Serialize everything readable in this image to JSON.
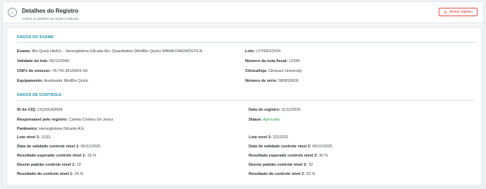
{
  "header": {
    "title": "Detalhes do Registro",
    "subtitle": "Confira os detalhes do registro realizado",
    "cancel_label": "Anular registro"
  },
  "exam_section": {
    "title": "DADOS DO EXAME",
    "left": [
      {
        "label": "Exame:",
        "value": "Bio Quick HbA1c - Hemoglobina Glicada A1c Quantitativo (MiniBio Quick) WAMA DIAGNÓSTICA"
      },
      {
        "label": "Validade do lote:",
        "value": "05/12/2040"
      },
      {
        "label": "CNPJ do emissor:",
        "value": "78.742.961/0001-69"
      },
      {
        "label": "Equipamento:",
        "value": "Analisador MiniBio Quick"
      }
    ],
    "right": [
      {
        "label": "Lote:",
        "value": "LOTERX2024"
      },
      {
        "label": "Número da nota fiscal:",
        "value": "12345"
      },
      {
        "label": "Clínica/loja:",
        "value": "Clinicarx University"
      },
      {
        "label": "Número de série:",
        "value": "080819918"
      }
    ]
  },
  "control_section": {
    "title": "DADOS DE CONTROLE",
    "left": [
      {
        "label": "ID do CIQ:",
        "value": "CIQ331A0004"
      },
      {
        "label": "Responsável pelo registro:",
        "value": "Camila Cristina De Jesus"
      },
      {
        "label": "Parâmetro:",
        "value": "Hemoglobina Glicada A1c"
      },
      {
        "label": "Lote nível 1:",
        "value": "11111"
      },
      {
        "label": "Data de validade controle nível 1:",
        "value": "06/12/2025"
      },
      {
        "label": "Resultado esperado controle nível 1:",
        "value": "15 %"
      },
      {
        "label": "Desvio padrão controle nível 1:",
        "value": "10"
      },
      {
        "label": "Resultado do controle nível 1:",
        "value": "26 %"
      }
    ],
    "right": [
      {
        "label": "Data do registro:",
        "value": "11/11/2025"
      },
      {
        "label": "Status:",
        "value": "Aprovado"
      },
      {
        "label": "Lote nível 2:",
        "value": "2222222"
      },
      {
        "label": "Data de validade controle nível 2:",
        "value": "06/12/2025"
      },
      {
        "label": "Resultado esperado controle nível 2:",
        "value": "30 %"
      },
      {
        "label": "Desvio padrão controle nível 2:",
        "value": "10"
      },
      {
        "label": "Resultado do controle nível 2:",
        "value": "32 %"
      }
    ]
  },
  "colors": {
    "accent": "#1b8fa7",
    "danger": "#d93a3a",
    "success": "#2e9b47"
  }
}
